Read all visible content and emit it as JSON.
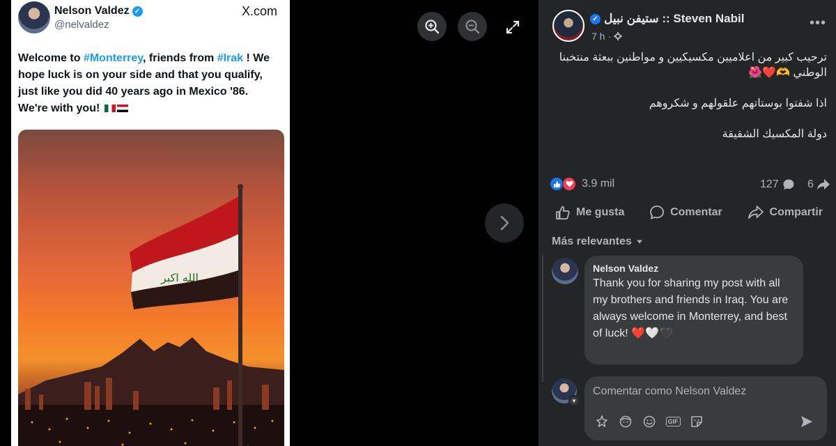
{
  "colors": {
    "fb_panel_bg": "#242526",
    "fb_bubble_bg": "#3a3b3c",
    "fb_text": "#e4e6eb",
    "fb_secondary": "#b0b3b8",
    "x_link": "#1d9bf0",
    "like_blue": "#1877f2",
    "love_red": "#f33e58"
  },
  "viewer": {
    "zoom_in_icon": "zoom-in-icon",
    "zoom_out_icon": "zoom-out-icon",
    "expand_icon": "expand-icon",
    "next_icon": "chevron-right-icon"
  },
  "tweet": {
    "author_name": "Nelson Valdez",
    "author_handle": "@nelvaldez",
    "site": "X.com",
    "text_parts": {
      "p1": "Welcome to ",
      "tag1": "#Monterrey",
      "p2": ", friends from ",
      "tag2": "#Irak",
      "p3": " ! We hope luck is on your side and that you qualify, just like you did 40 years ago in Mexico '86. We're with you! "
    },
    "flag_text": "الله اكبر"
  },
  "post": {
    "page_name": "ستيفن نبيل :: Steven Nabil",
    "time": "7 h",
    "paragraphs": [
      "ترحيب كبير من اعلاميين مكسيكيين و مواطنين ببعثة منتخبنا الوطني 🫶❤️🌺",
      "اذا شفتوا بوستاتهم علقولهم و شكروهم",
      "دولة المكسيك الشقيقة"
    ],
    "reaction_count": "3.9 mil",
    "comment_count": "127",
    "share_count": "6"
  },
  "actions": {
    "like": "Me gusta",
    "comment": "Comentar",
    "share": "Compartir"
  },
  "comments": {
    "sort_label": "Más relevantes",
    "items": [
      {
        "author": "Nelson Valdez",
        "text": "Thank you for sharing my post with all my brothers and friends in Iraq. You are always welcome in Monterrey, and best of luck! ❤️🤍🖤"
      }
    ]
  },
  "composer": {
    "placeholder": "Comentar como Nelson Valdez",
    "gif_label": "GIF"
  }
}
